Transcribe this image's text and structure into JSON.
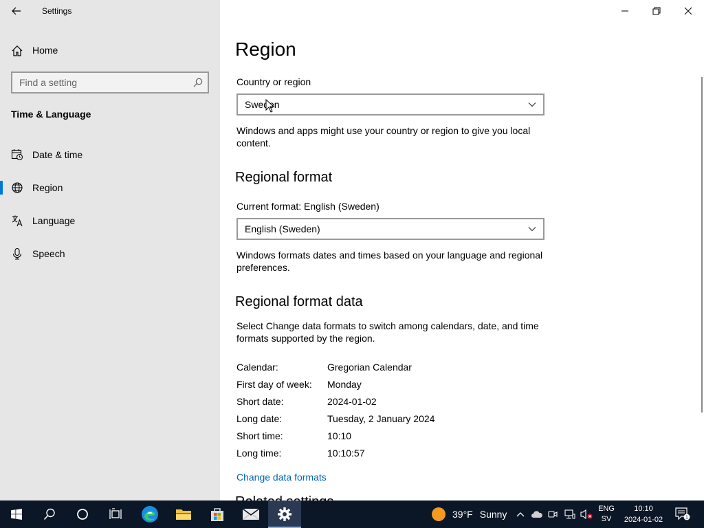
{
  "window": {
    "app_title": "Settings"
  },
  "sidebar": {
    "home_label": "Home",
    "search_placeholder": "Find a setting",
    "section_title": "Time & Language",
    "items": [
      {
        "label": "Date & time",
        "icon": "date-time-icon"
      },
      {
        "label": "Region",
        "icon": "globe-icon",
        "active": true
      },
      {
        "label": "Language",
        "icon": "language-icon"
      },
      {
        "label": "Speech",
        "icon": "microphone-icon"
      }
    ]
  },
  "main": {
    "title": "Region",
    "country": {
      "label": "Country or region",
      "value": "Sweden",
      "description": "Windows and apps might use your country or region to give you local content."
    },
    "regional_format": {
      "heading": "Regional format",
      "label": "Current format: English (Sweden)",
      "value": "English (Sweden)",
      "description": "Windows formats dates and times based on your language and regional preferences."
    },
    "format_data": {
      "heading": "Regional format data",
      "description": "Select Change data formats to switch among calendars, date, and time formats supported by the region.",
      "rows": [
        {
          "key": "Calendar:",
          "value": "Gregorian Calendar"
        },
        {
          "key": "First day of week:",
          "value": "Monday"
        },
        {
          "key": "Short date:",
          "value": "2024-01-02"
        },
        {
          "key": "Long date:",
          "value": "Tuesday, 2 January 2024"
        },
        {
          "key": "Short time:",
          "value": "10:10"
        },
        {
          "key": "Long time:",
          "value": "10:10:57"
        }
      ],
      "link": "Change data formats"
    },
    "cut_heading": "Related settings"
  },
  "taskbar": {
    "weather_temp": "39°F",
    "weather_condition": "Sunny",
    "lang_line1": "ENG",
    "lang_line2": "SV",
    "time": "10:10",
    "date": "2024-01-02",
    "notification_count": "1"
  },
  "colors": {
    "accent": "#0078d7",
    "link": "#0067b8",
    "sidebar_bg": "#e6e6e6",
    "taskbar_bg": "#0b1626"
  }
}
